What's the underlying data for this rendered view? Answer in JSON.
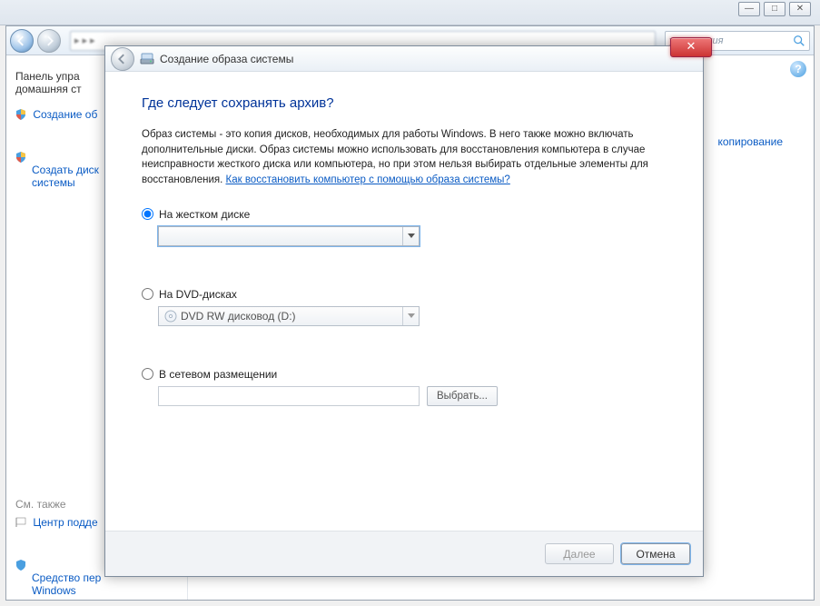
{
  "bg": {
    "control_panel_search": "управления",
    "sidebar_header": "Панель упра\nдомашняя ст",
    "sidelink1": "Создание об",
    "sidelink2": "Создать диск\nсистемы",
    "see_also": "См. также",
    "support_center": "Центр подде",
    "recovery_tool": "Средство пер\nWindows",
    "main_link": "копирование"
  },
  "wizard": {
    "title": "Создание образа системы",
    "heading": "Где следует сохранять архив?",
    "description": "Образ системы - это копия дисков, необходимых для работы Windows. В него также можно включать дополнительные диски. Образ системы можно использовать для восстановления компьютера в случае неисправности жесткого диска или компьютера, но при этом нельзя выбирать отдельные элементы для восстановления. ",
    "help_link": "Как восстановить компьютер с помощью образа системы?",
    "opt_hdd": "На жестком диске",
    "opt_dvd": "На DVD-дисках",
    "dvd_value": "DVD RW дисковод (D:)",
    "opt_net": "В сетевом размещении",
    "browse_btn": "Выбрать...",
    "next_btn": "Далее",
    "cancel_btn": "Отмена"
  }
}
